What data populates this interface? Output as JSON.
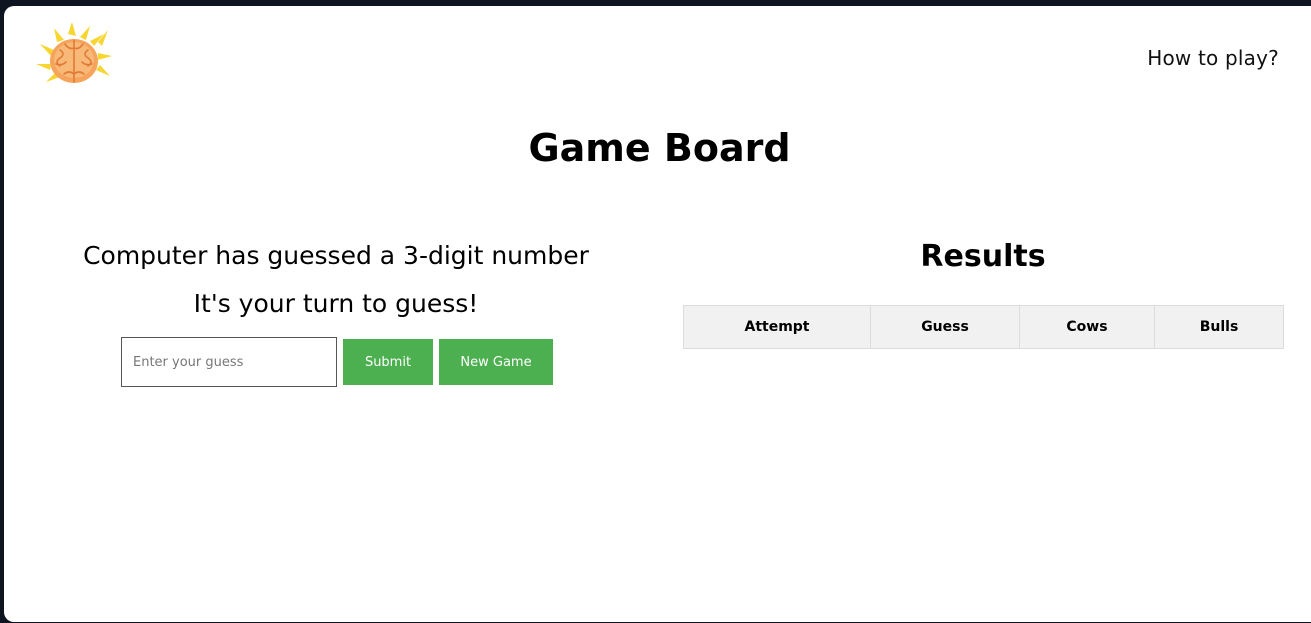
{
  "header": {
    "logo_icon": "brain-lightning-icon",
    "how_to_play": "How to play?"
  },
  "page_title": "Game Board",
  "game": {
    "message_line1": "Computer has guessed a 3-digit number",
    "message_line2": "It's your turn to guess!",
    "guess_placeholder": "Enter your guess",
    "guess_value": "",
    "submit_label": "Submit",
    "new_game_label": "New Game"
  },
  "results": {
    "title": "Results",
    "columns": [
      "Attempt",
      "Guess",
      "Cows",
      "Bulls"
    ],
    "rows": []
  },
  "colors": {
    "accent_green": "#4caf50",
    "header_bg": "#f1f1f1",
    "frame_bg": "#0e1521"
  }
}
